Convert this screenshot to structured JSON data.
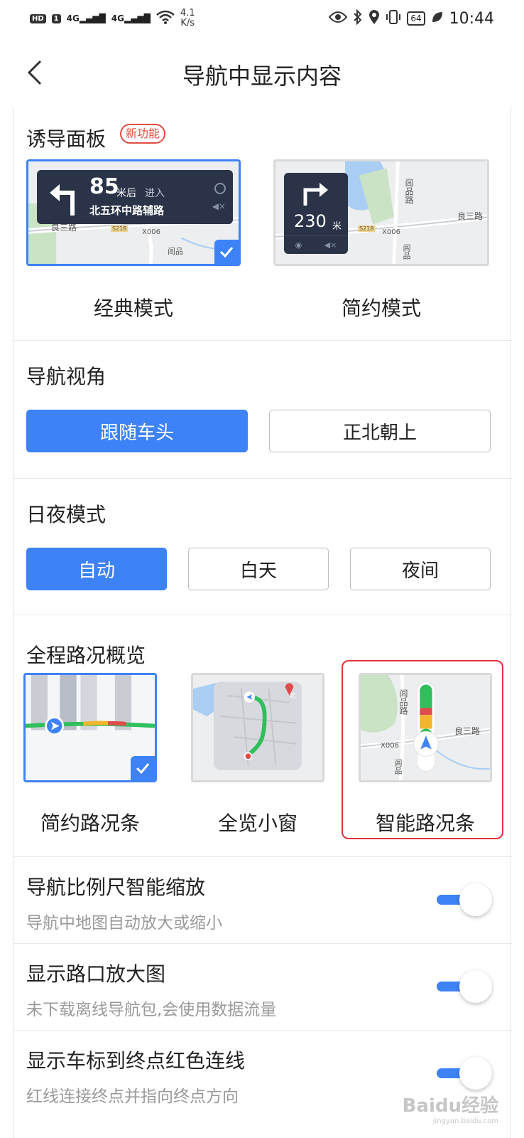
{
  "status_bar": {
    "hd": "HD",
    "sim": "1",
    "net1": "4G",
    "net2": "4G",
    "speed_value": "4.1",
    "speed_unit": "K/s",
    "battery": "64",
    "time": "10:44"
  },
  "header": {
    "title": "导航中显示内容"
  },
  "guidance_panel": {
    "title": "诱导面板",
    "badge": "新功能",
    "options": [
      {
        "label": "经典模式",
        "selected": true,
        "preview": {
          "distance": "85",
          "unit": "米后",
          "action": "进入",
          "road": "北五环中路辅路",
          "map_labels": [
            "良三路",
            "X006",
            "闾品",
            "S218"
          ]
        }
      },
      {
        "label": "简约模式",
        "selected": false,
        "preview": {
          "distance": "230",
          "unit": "米",
          "map_labels": [
            "闾品路",
            "良三路",
            "X006",
            "闾品",
            "S218"
          ]
        }
      }
    ]
  },
  "view_angle": {
    "title": "导航视角",
    "options": [
      {
        "label": "跟随车头",
        "selected": true
      },
      {
        "label": "正北朝上",
        "selected": false
      }
    ]
  },
  "day_night": {
    "title": "日夜模式",
    "options": [
      {
        "label": "自动",
        "selected": true
      },
      {
        "label": "白天",
        "selected": false
      },
      {
        "label": "夜间",
        "selected": false
      }
    ]
  },
  "traffic_overview": {
    "title": "全程路况概览",
    "options": [
      {
        "label": "简约路况条",
        "selected": true
      },
      {
        "label": "全览小窗",
        "selected": false,
        "preview": {
          "north": "北"
        }
      },
      {
        "label": "智能路况条",
        "selected": false,
        "highlighted": true,
        "preview": {
          "map_labels": [
            "闾品路",
            "良三路",
            "X006",
            "闾品"
          ]
        }
      }
    ]
  },
  "settings": [
    {
      "title": "导航比例尺智能缩放",
      "subtitle": "导航中地图自动放大或缩小",
      "enabled": true
    },
    {
      "title": "显示路口放大图",
      "subtitle": "未下载离线导航包,会使用数据流量",
      "enabled": true
    },
    {
      "title": "显示车标到终点红色连线",
      "subtitle": "红线连接终点并指向终点方向",
      "enabled": true
    }
  ],
  "watermark": {
    "text": "Baidu经验",
    "sub": "jingyan.baidu.com"
  },
  "colors": {
    "accent": "#3e82f7",
    "badge_red": "#e34b45",
    "highlight_red": "#e0323a"
  }
}
